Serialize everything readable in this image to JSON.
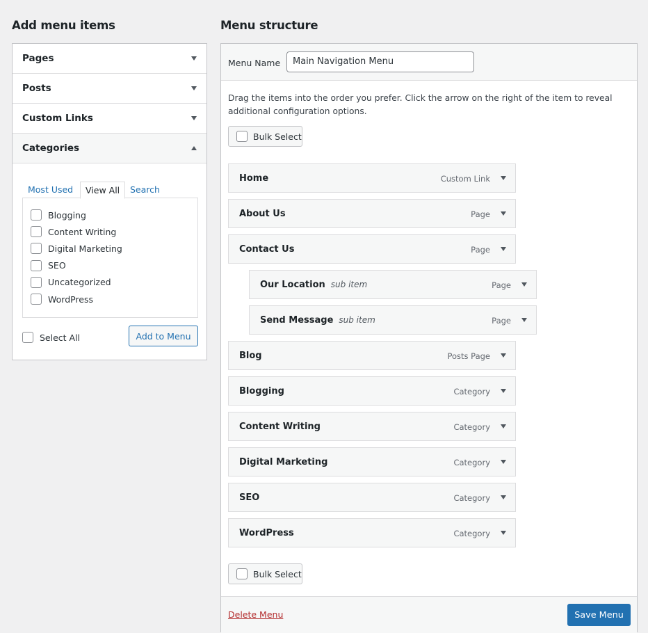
{
  "left": {
    "title": "Add menu items",
    "sections": [
      {
        "label": "Pages"
      },
      {
        "label": "Posts"
      },
      {
        "label": "Custom Links"
      },
      {
        "label": "Categories"
      }
    ],
    "tabs": {
      "most_used": "Most Used",
      "view_all": "View All",
      "search": "Search"
    },
    "categories": [
      "Blogging",
      "Content Writing",
      "Digital Marketing",
      "SEO",
      "Uncategorized",
      "WordPress"
    ],
    "select_all": "Select All",
    "add_to_menu": "Add to Menu"
  },
  "right": {
    "title": "Menu structure",
    "menu_name_label": "Menu Name",
    "menu_name_value": "Main Navigation Menu",
    "instructions": "Drag the items into the order you prefer. Click the arrow on the right of the item to reveal additional configuration options.",
    "bulk_select": "Bulk Select",
    "items": [
      {
        "title": "Home",
        "sub": "",
        "type": "Custom Link"
      },
      {
        "title": "About Us",
        "sub": "",
        "type": "Page"
      },
      {
        "title": "Contact Us",
        "sub": "",
        "type": "Page"
      },
      {
        "title": "Our Location",
        "sub": "sub item",
        "type": "Page"
      },
      {
        "title": "Send Message",
        "sub": "sub item",
        "type": "Page"
      },
      {
        "title": "Blog",
        "sub": "",
        "type": "Posts Page"
      },
      {
        "title": "Blogging",
        "sub": "",
        "type": "Category"
      },
      {
        "title": "Content Writing",
        "sub": "",
        "type": "Category"
      },
      {
        "title": "Digital Marketing",
        "sub": "",
        "type": "Category"
      },
      {
        "title": "SEO",
        "sub": "",
        "type": "Category"
      },
      {
        "title": "WordPress",
        "sub": "",
        "type": "Category"
      }
    ],
    "delete_menu": "Delete Menu",
    "save_menu": "Save Menu"
  },
  "colors": {
    "accent": "#2271b1",
    "danger": "#b32d2e",
    "background": "#f0f0f1"
  },
  "icons": {
    "expand": "triangle-down-icon",
    "collapse": "triangle-up-icon"
  }
}
